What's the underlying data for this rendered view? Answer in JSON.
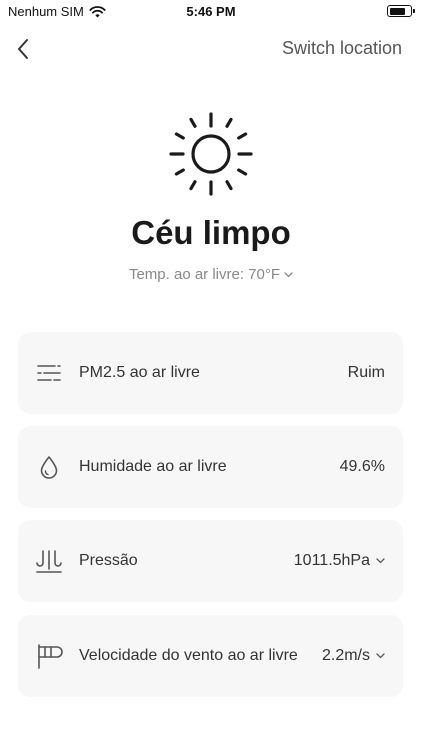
{
  "status_bar": {
    "carrier": "Nenhum SIM",
    "time": "5:46 PM",
    "battery_level": 0.8
  },
  "nav": {
    "back_icon": "chevron-left-icon",
    "switch_location": "Switch location"
  },
  "weather": {
    "icon": "sun-icon",
    "condition": "Céu limpo",
    "outdoor_temp": "Temp. ao ar livre: 70°F"
  },
  "cards": [
    {
      "icon": "pm25-icon",
      "label": "PM2.5 ao ar livre",
      "value": "Ruim",
      "has_dropdown": false
    },
    {
      "icon": "droplet-icon",
      "label": "Humidade ao ar livre",
      "value": "49.6%",
      "has_dropdown": false
    },
    {
      "icon": "pressure-icon",
      "label": "Pressão",
      "value": "1011.5hPa",
      "has_dropdown": true
    },
    {
      "icon": "wind-flag-icon",
      "label": "Velocidade do vento ao ar livre",
      "value": "2.2m/s",
      "has_dropdown": true
    }
  ]
}
